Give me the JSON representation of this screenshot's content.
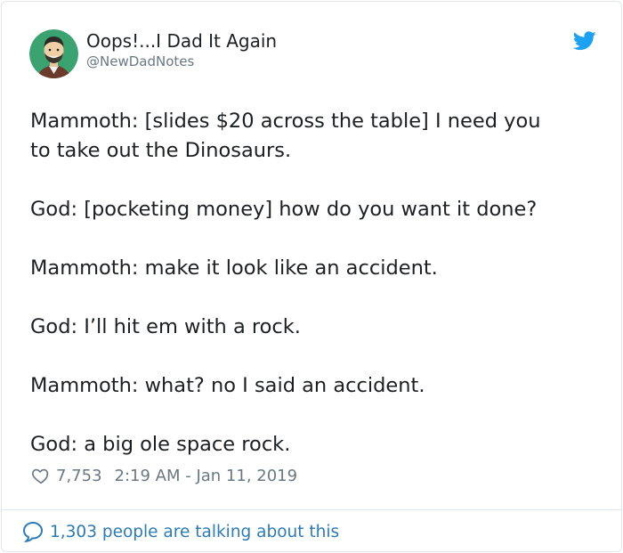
{
  "user": {
    "display_name": "Oops!...I Dad It Again",
    "handle": "@NewDadNotes",
    "avatar_bg": "#3aa36f"
  },
  "icons": {
    "brand": "twitter-bird-icon",
    "like": "heart-icon",
    "reply": "speech-bubble-icon"
  },
  "colors": {
    "brand": "#1da1f2",
    "link": "#2b7bb9",
    "muted": "#697882"
  },
  "tweet": {
    "lines": [
      "Mammoth: [slides $20 across the table] I need you",
      "to take out the Dinosaurs.",
      "God: [pocketing money] how do you want it done?",
      "Mammoth: make it look like an accident.",
      "God: I’ll hit em with a rock.",
      "Mammoth: what? no I said an accident.",
      "God: a big ole space rock."
    ]
  },
  "meta": {
    "likes": "7,753",
    "timestamp": "2:19 AM - Jan 11, 2019"
  },
  "footer": {
    "talking": "1,303 people are talking about this"
  }
}
